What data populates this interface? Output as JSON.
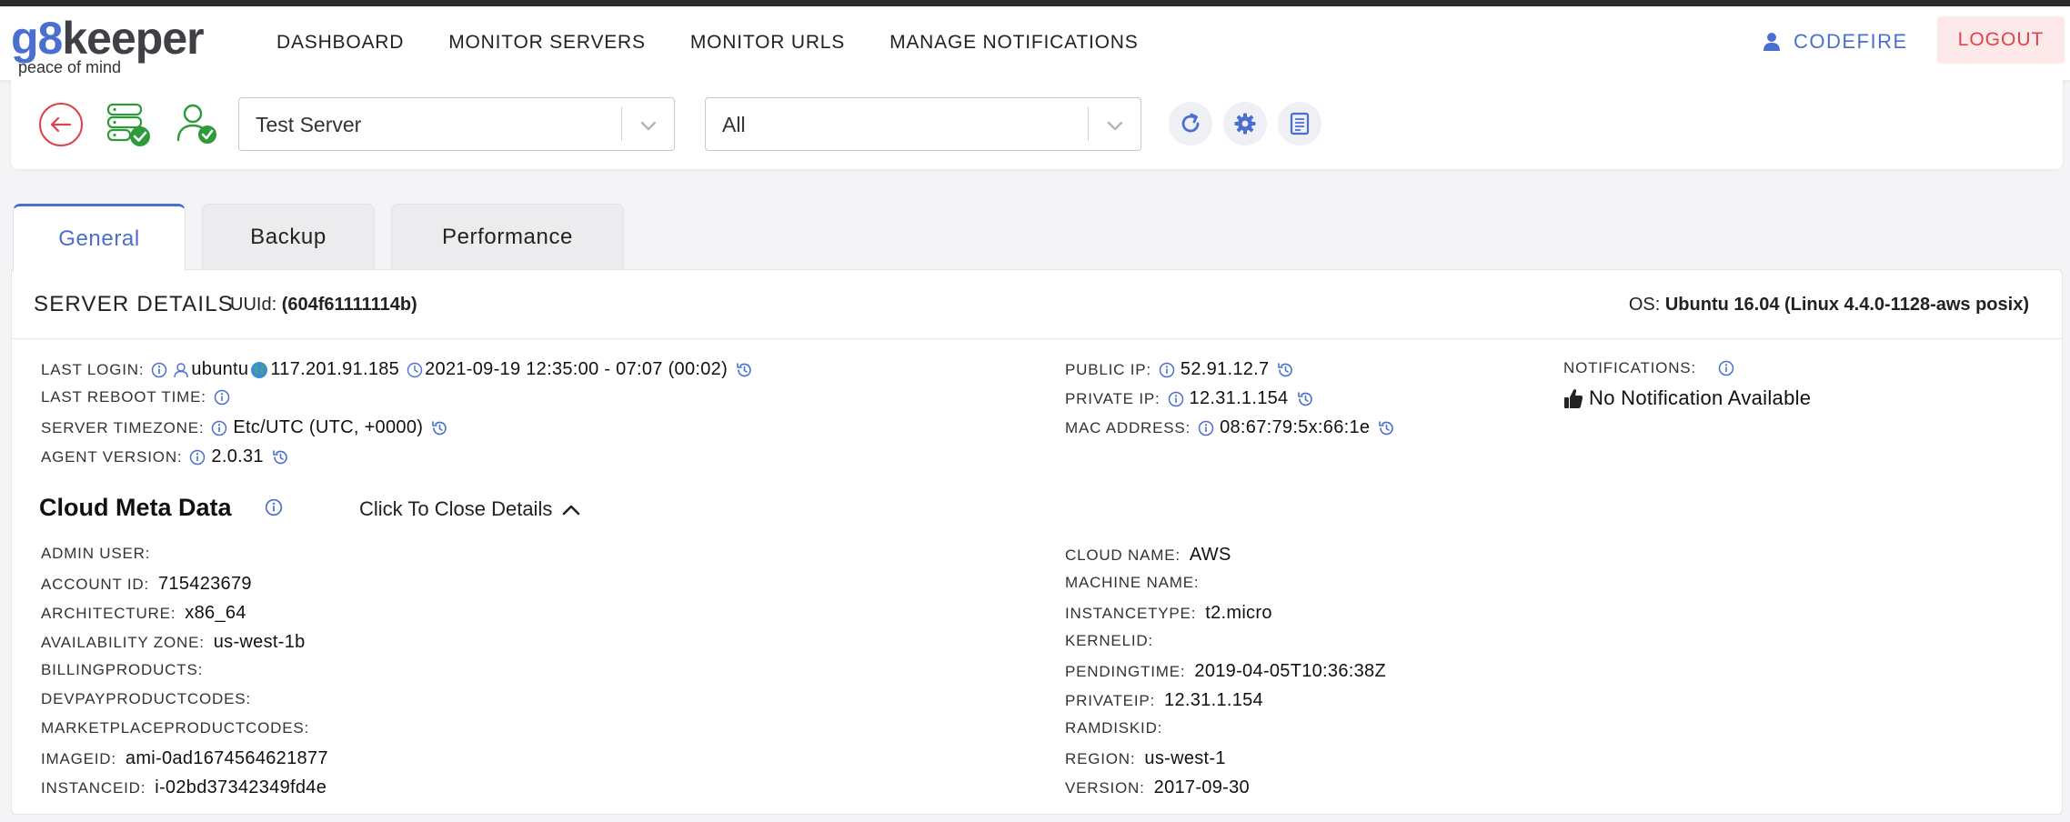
{
  "header": {
    "logo": {
      "main_prefix": "g8",
      "main_suffix": "keeper",
      "tagline": "peace of mind"
    },
    "nav": [
      {
        "label": "DASHBOARD"
      },
      {
        "label": "MONITOR SERVERS"
      },
      {
        "label": "MONITOR URLS"
      },
      {
        "label": "MANAGE NOTIFICATIONS"
      }
    ],
    "user": {
      "name": "CODEFIRE",
      "icon": "user-icon"
    },
    "logout_label": "LOGOUT"
  },
  "toolbar": {
    "server_select": {
      "value": "Test Server"
    },
    "filter_select": {
      "value": "All"
    },
    "icons": [
      "back-arrow-icon",
      "server-check-icon",
      "user-check-icon",
      "refresh-icon",
      "settings-gear-icon",
      "document-list-icon"
    ]
  },
  "tabs": [
    {
      "label": "General",
      "active": true
    },
    {
      "label": "Backup",
      "active": false
    },
    {
      "label": "Performance",
      "active": false
    }
  ],
  "server_details": {
    "title": "SERVER DETAILS",
    "uuid_label": "UUId:",
    "uuid_value": "(604f61111114b)",
    "os_label": "OS:",
    "os_value": "Ubuntu 16.04  (Linux 4.4.0-1128-aws  posix)",
    "last_login": {
      "label": "LAST LOGIN:",
      "user": "ubuntu",
      "ip": "117.201.91.185",
      "time": "2021-09-19 12:35:00 - 07:07 (00:02)"
    },
    "last_reboot": {
      "label": "LAST REBOOT TIME:",
      "value": ""
    },
    "timezone": {
      "label": "SERVER TIMEZONE:",
      "value": "Etc/UTC (UTC, +0000)"
    },
    "agent_version": {
      "label": "AGENT VERSION:",
      "value": "2.0.31"
    },
    "public_ip": {
      "label": "PUBLIC IP:",
      "value": "52.91.12.7"
    },
    "private_ip": {
      "label": "PRIVATE IP:",
      "value": "12.31.1.154"
    },
    "mac_address": {
      "label": "MAC ADDRESS:",
      "value": "08:67:79:5x:66:1e"
    },
    "notifications": {
      "label": "NOTIFICATIONS:",
      "value": "No Notification Available"
    }
  },
  "cloud_meta": {
    "title": "Cloud Meta Data",
    "toggle_label": "Click To Close Details",
    "left": [
      {
        "label": "ADMIN USER:",
        "value": ""
      },
      {
        "label": "ACCOUNT ID:",
        "value": "715423679"
      },
      {
        "label": "ARCHITECTURE:",
        "value": "x86_64"
      },
      {
        "label": "AVAILABILITY ZONE:",
        "value": "us-west-1b"
      },
      {
        "label": "BILLINGPRODUCTS:",
        "value": ""
      },
      {
        "label": "DEVPAYPRODUCTCODES:",
        "value": ""
      },
      {
        "label": "MARKETPLACEPRODUCTCODES:",
        "value": ""
      },
      {
        "label": "IMAGEID:",
        "value": "ami-0ad1674564621877"
      },
      {
        "label": "INSTANCEID:",
        "value": "i-02bd37342349fd4e"
      }
    ],
    "right": [
      {
        "label": "CLOUD NAME:",
        "value": "AWS"
      },
      {
        "label": "MACHINE NAME:",
        "value": ""
      },
      {
        "label": "INSTANCETYPE:",
        "value": "t2.micro"
      },
      {
        "label": "KERNELID:",
        "value": ""
      },
      {
        "label": "PENDINGTIME:",
        "value": "2019-04-05T10:36:38Z"
      },
      {
        "label": "PRIVATEIP:",
        "value": "12.31.1.154"
      },
      {
        "label": "RAMDISKID:",
        "value": ""
      },
      {
        "label": "REGION:",
        "value": "us-west-1"
      },
      {
        "label": "VERSION:",
        "value": "2017-09-30"
      }
    ]
  },
  "colors": {
    "accent": "#4a6fd0",
    "logout_text": "#e0424a",
    "logout_bg": "#fde9ea",
    "success_green": "#2e9a3a",
    "back_red": "#e0424a"
  }
}
